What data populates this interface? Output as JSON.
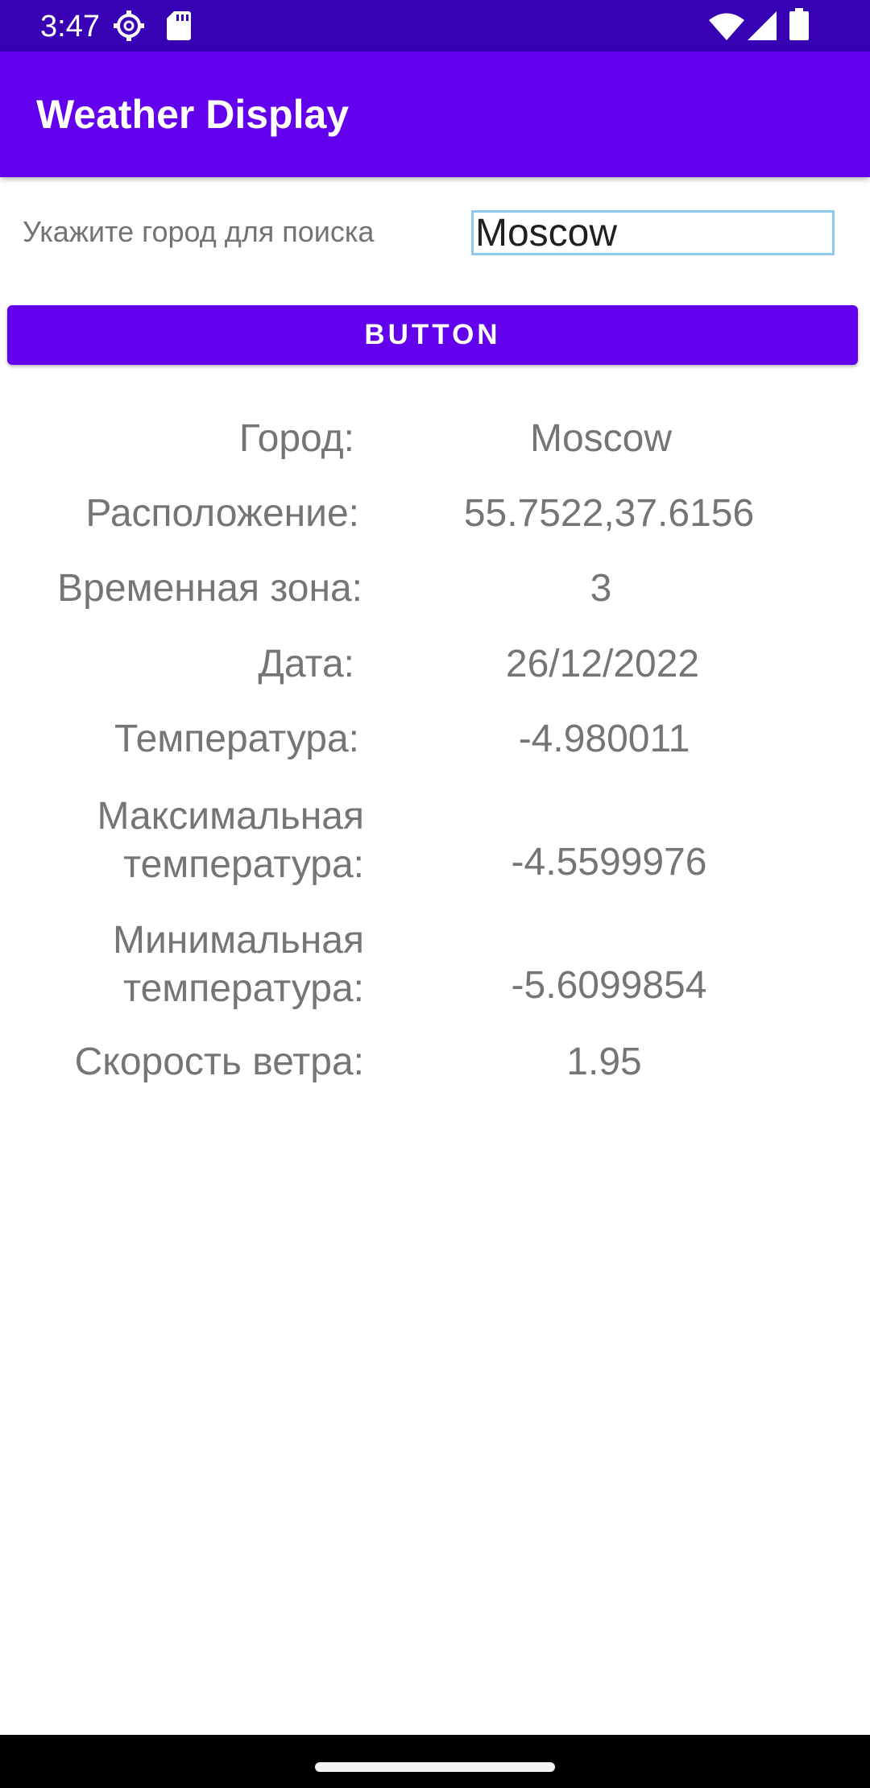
{
  "status_bar": {
    "time": "3:47",
    "icons": [
      "settings-gear-icon",
      "sd-card-icon",
      "wifi-icon",
      "cell-signal-icon",
      "battery-icon"
    ]
  },
  "app_bar": {
    "title": "Weather Display"
  },
  "search": {
    "label": "Укажите город для поиска",
    "value": "Moscow"
  },
  "button": {
    "label": "BUTTON"
  },
  "results": {
    "city": {
      "label": "Город:",
      "value": "Moscow"
    },
    "location": {
      "label": "Расположение:",
      "value": "55.7522,37.6156"
    },
    "timezone": {
      "label": "Временная зона:",
      "value": "3"
    },
    "date": {
      "label": "Дата:",
      "value": "26/12/2022"
    },
    "temperature": {
      "label": "Температура:",
      "value": "-4.980011"
    },
    "max_temperature": {
      "label_line1": "Максимальная",
      "label_line2": "температура:",
      "value": "-4.5599976"
    },
    "min_temperature": {
      "label_line1": "Минимальная",
      "label_line2": "температура:",
      "value": "-5.6099854"
    },
    "wind_speed": {
      "label": "Скорость ветра:",
      "value": "1.95"
    }
  },
  "colors": {
    "status_bar": "#3700b3",
    "primary": "#6200ee",
    "text_secondary": "#757575",
    "input_border": "#8ec9f0"
  }
}
